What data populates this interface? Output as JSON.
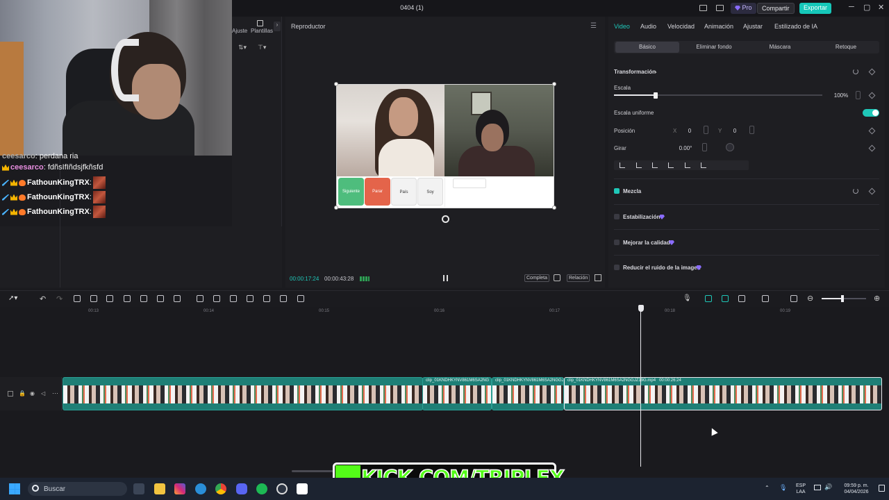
{
  "window": {
    "title": "0404 (1)",
    "pro": "Pro",
    "share": "Compartir",
    "export": "Exportar"
  },
  "left_panel": {
    "tab_adjust": "Ajuste",
    "tab_templates": "Plantillas"
  },
  "chat": [
    {
      "user": "ceesarco",
      "msg": "perdana ria"
    },
    {
      "user": "ceesarco",
      "msg": "fdñsIfIñdsjfkñsfd"
    },
    {
      "user": "FathounKingTRX",
      "msg": ""
    },
    {
      "user": "FathounKingTRX",
      "msg": ""
    },
    {
      "user": "FathounKingTRX",
      "msg": ""
    }
  ],
  "player": {
    "title": "Reproductor",
    "current_time": "00:00:17:24",
    "total_time": "00:00:43:28",
    "btn_full": "Completa",
    "btn_ratio": "Relación",
    "video_buttons": [
      "Siguiente",
      "Parar",
      "País",
      "Soy"
    ]
  },
  "inspector": {
    "tabs": [
      "Video",
      "Audio",
      "Velocidad",
      "Animación",
      "Ajustar",
      "Estilizado de IA"
    ],
    "subtabs": [
      "Básico",
      "Eliminar fondo",
      "Máscara",
      "Retoque"
    ],
    "transform_title": "Transformación",
    "scale_label": "Escala",
    "scale_value": "100%",
    "scale_fraction": 0.2,
    "uniform_label": "Escala uniforme",
    "position_label": "Posición",
    "pos_x_label": "X",
    "pos_x": "0",
    "pos_y_label": "Y",
    "pos_y": "0",
    "rotate_label": "Girar",
    "rotate_value": "0.00°",
    "blend_label": "Mezcla",
    "stabilize_label": "Estabilización",
    "quality_label": "Mejorar la calidad",
    "noise_label": "Reducir el ruido de la imagen"
  },
  "timeline": {
    "ruler": [
      "00:13",
      "00:14",
      "00:15",
      "00:16",
      "00:17",
      "00:18",
      "00:19"
    ],
    "clips": [
      {
        "label": "clip_01KNDHKYNV861M6SA2NG"
      },
      {
        "label": "clip_01KNDHKYNV861M6SA2NGGJ"
      },
      {
        "label": "clip_01KNDHKYNV861M6SA2NGGJZ19G.mp4",
        "duration": "00:00:26:24"
      }
    ]
  },
  "kick": {
    "text": "KICK.COM/TRIPLEX"
  },
  "taskbar": {
    "search": "Buscar",
    "lang1": "ESP",
    "lang2": "LAA",
    "time": "09:59 p. m.",
    "date": "04/04/2026"
  },
  "colors": {
    "accent": "#1fc7b8",
    "kick": "#53fc18"
  }
}
